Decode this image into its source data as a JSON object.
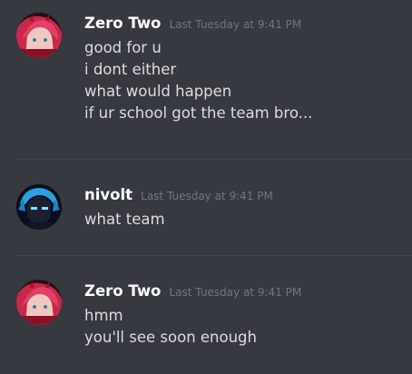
{
  "messages": [
    {
      "username": "Zero Two",
      "timestamp": "Last Tuesday at 9:41 PM",
      "avatar": "zero-two-avatar",
      "lines": [
        "good for u",
        "i dont either",
        "what would happen",
        "if ur school got the team bro..."
      ]
    },
    {
      "username": "nivolt",
      "timestamp": "Last Tuesday at 9:41 PM",
      "avatar": "nivolt-avatar",
      "lines": [
        "what team"
      ]
    },
    {
      "username": "Zero Two",
      "timestamp": "Last Tuesday at 9:41 PM",
      "avatar": "zero-two-avatar",
      "lines": [
        "hmm",
        "you'll see soon enough"
      ]
    }
  ],
  "colors": {
    "background": "#36393f",
    "username": "#ffffff",
    "text": "#dcddde",
    "timestamp": "#72767d",
    "divider": "#42454a"
  }
}
